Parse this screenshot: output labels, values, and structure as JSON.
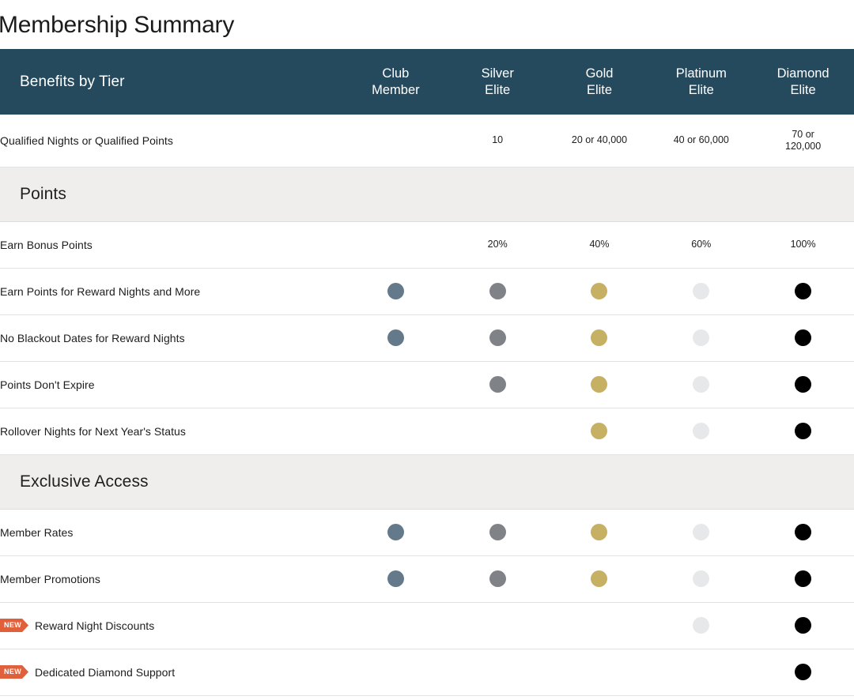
{
  "page": {
    "title": "Membership Summary"
  },
  "table": {
    "header": {
      "label": "Benefits by Tier",
      "tiers": [
        {
          "key": "club",
          "line1": "Club",
          "line2": "Member"
        },
        {
          "key": "silver",
          "line1": "Silver",
          "line2": "Elite"
        },
        {
          "key": "gold",
          "line1": "Gold",
          "line2": "Elite"
        },
        {
          "key": "platinum",
          "line1": "Platinum",
          "line2": "Elite"
        },
        {
          "key": "diamond",
          "line1": "Diamond",
          "line2": "Elite"
        }
      ]
    },
    "rows": [
      {
        "type": "data",
        "label": "Qualified Nights or Qualified Points",
        "badge": null,
        "tall": true,
        "cells": [
          {
            "kind": "empty",
            "text": ""
          },
          {
            "kind": "text",
            "text": "10"
          },
          {
            "kind": "text",
            "text": "20 or 40,000"
          },
          {
            "kind": "text",
            "text": "40 or 60,000"
          },
          {
            "kind": "text2",
            "text": "70 or",
            "text2": "120,000"
          }
        ]
      },
      {
        "type": "section",
        "label": "Points"
      },
      {
        "type": "data",
        "label": "Earn Bonus Points",
        "badge": null,
        "cells": [
          {
            "kind": "empty",
            "text": ""
          },
          {
            "kind": "text",
            "text": "20%"
          },
          {
            "kind": "text",
            "text": "40%"
          },
          {
            "kind": "text",
            "text": "60%"
          },
          {
            "kind": "text",
            "text": "100%"
          }
        ]
      },
      {
        "type": "data",
        "label": "Earn Points for Reward Nights and More",
        "badge": null,
        "cells": [
          {
            "kind": "dot",
            "tier": "club"
          },
          {
            "kind": "dot",
            "tier": "silver"
          },
          {
            "kind": "dot",
            "tier": "gold"
          },
          {
            "kind": "dot",
            "tier": "platinum"
          },
          {
            "kind": "dot",
            "tier": "diamond"
          }
        ]
      },
      {
        "type": "data",
        "label": "No Blackout Dates for Reward Nights",
        "badge": null,
        "cells": [
          {
            "kind": "dot",
            "tier": "club"
          },
          {
            "kind": "dot",
            "tier": "silver"
          },
          {
            "kind": "dot",
            "tier": "gold"
          },
          {
            "kind": "dot",
            "tier": "platinum"
          },
          {
            "kind": "dot",
            "tier": "diamond"
          }
        ]
      },
      {
        "type": "data",
        "label": "Points Don't Expire",
        "badge": null,
        "cells": [
          {
            "kind": "empty"
          },
          {
            "kind": "dot",
            "tier": "silver"
          },
          {
            "kind": "dot",
            "tier": "gold"
          },
          {
            "kind": "dot",
            "tier": "platinum"
          },
          {
            "kind": "dot",
            "tier": "diamond"
          }
        ]
      },
      {
        "type": "data",
        "label": "Rollover Nights for Next Year's Status",
        "badge": null,
        "cells": [
          {
            "kind": "empty"
          },
          {
            "kind": "empty"
          },
          {
            "kind": "dot",
            "tier": "gold"
          },
          {
            "kind": "dot",
            "tier": "platinum"
          },
          {
            "kind": "dot",
            "tier": "diamond"
          }
        ]
      },
      {
        "type": "section",
        "label": "Exclusive Access"
      },
      {
        "type": "data",
        "label": "Member Rates",
        "badge": null,
        "cells": [
          {
            "kind": "dot",
            "tier": "club"
          },
          {
            "kind": "dot",
            "tier": "silver"
          },
          {
            "kind": "dot",
            "tier": "gold"
          },
          {
            "kind": "dot",
            "tier": "platinum"
          },
          {
            "kind": "dot",
            "tier": "diamond"
          }
        ]
      },
      {
        "type": "data",
        "label": "Member Promotions",
        "badge": null,
        "cells": [
          {
            "kind": "dot",
            "tier": "club"
          },
          {
            "kind": "dot",
            "tier": "silver"
          },
          {
            "kind": "dot",
            "tier": "gold"
          },
          {
            "kind": "dot",
            "tier": "platinum"
          },
          {
            "kind": "dot",
            "tier": "diamond"
          }
        ]
      },
      {
        "type": "data",
        "label": "Reward Night Discounts",
        "badge": "NEW",
        "cells": [
          {
            "kind": "empty"
          },
          {
            "kind": "empty"
          },
          {
            "kind": "empty"
          },
          {
            "kind": "dot",
            "tier": "platinum"
          },
          {
            "kind": "dot",
            "tier": "diamond"
          }
        ]
      },
      {
        "type": "data",
        "label": "Dedicated Diamond Support",
        "badge": "NEW",
        "cells": [
          {
            "kind": "empty"
          },
          {
            "kind": "empty"
          },
          {
            "kind": "empty"
          },
          {
            "kind": "empty"
          },
          {
            "kind": "dot",
            "tier": "diamond"
          }
        ]
      }
    ]
  },
  "colors": {
    "header_bg": "#254a5d",
    "section_bg": "#efeeec",
    "badge_bg": "#e0603c",
    "dot_club": "#64798a",
    "dot_silver": "#7f8286",
    "dot_gold": "#c5b063",
    "dot_platinum": "#e7e8e9",
    "dot_diamond": "#000000"
  }
}
